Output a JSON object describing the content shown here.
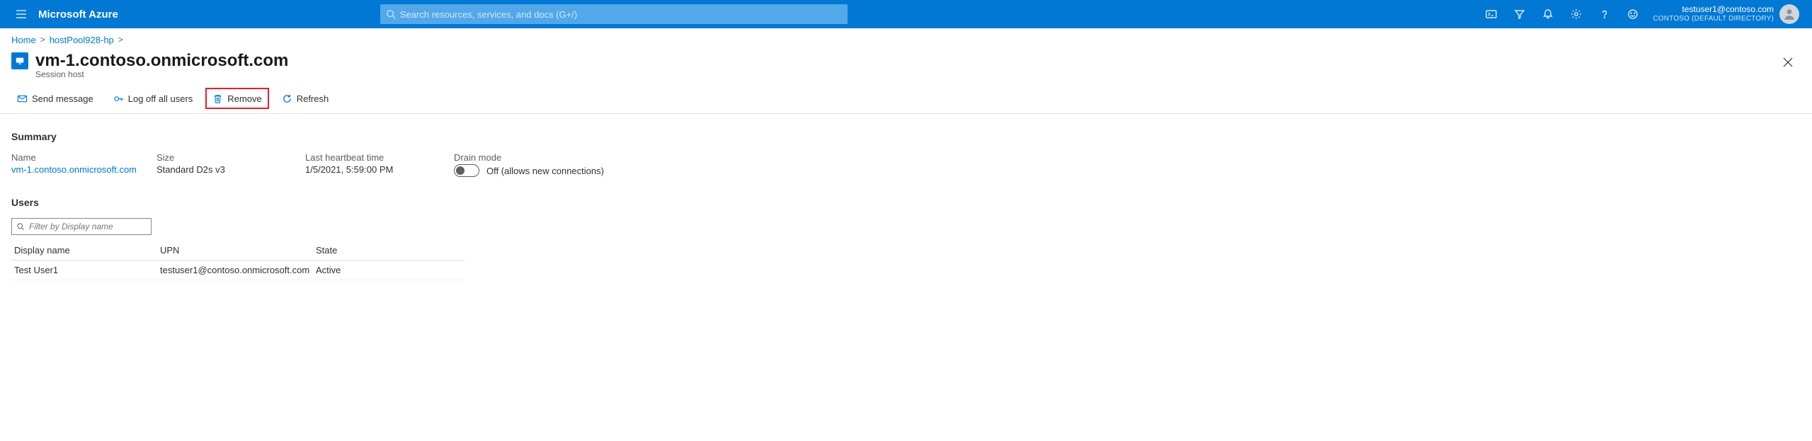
{
  "brand": "Microsoft Azure",
  "search": {
    "placeholder": "Search resources, services, and docs (G+/)"
  },
  "account": {
    "email": "testuser1@contoso.com",
    "directory": "CONTOSO (DEFAULT DIRECTORY)"
  },
  "breadcrumb": {
    "home": "Home",
    "parent": "hostPool928-hp"
  },
  "page": {
    "title": "vm-1.contoso.onmicrosoft.com",
    "subtitle": "Session host"
  },
  "commands": {
    "send_message": "Send message",
    "log_off": "Log off all users",
    "remove": "Remove",
    "refresh": "Refresh"
  },
  "summary": {
    "title": "Summary",
    "name_label": "Name",
    "name_value": "vm-1.contoso.onmicrosoft.com",
    "size_label": "Size",
    "size_value": "Standard D2s v3",
    "heartbeat_label": "Last heartbeat time",
    "heartbeat_value": "1/5/2021, 5:59:00 PM",
    "drain_label": "Drain mode",
    "drain_value": "Off (allows new connections)",
    "drain_on": false
  },
  "users": {
    "title": "Users",
    "filter_placeholder": "Filter by Display name",
    "columns": {
      "display_name": "Display name",
      "upn": "UPN",
      "state": "State"
    },
    "rows": [
      {
        "display_name": "Test User1",
        "upn": "testuser1@contoso.onmicrosoft.com",
        "state": "Active"
      }
    ]
  }
}
